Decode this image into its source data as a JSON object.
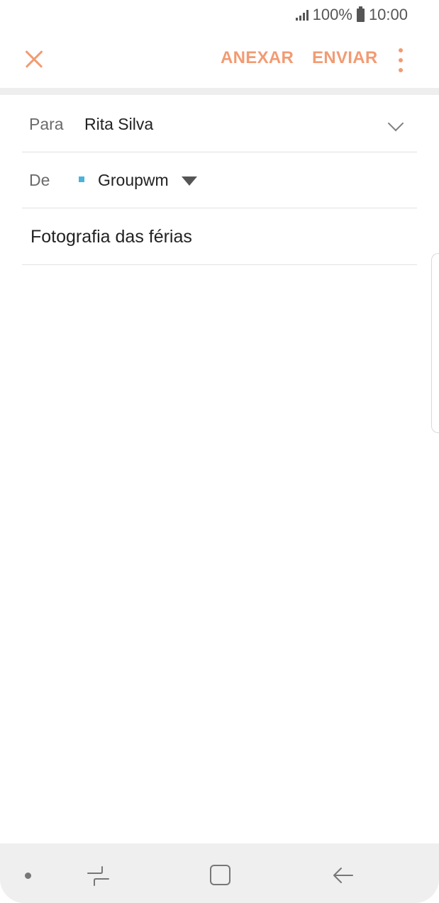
{
  "status_bar": {
    "battery": "100%",
    "time": "10:00",
    "icons": [
      "signal-icon",
      "battery-icon"
    ]
  },
  "toolbar": {
    "close_icon": "close-icon",
    "attach_label": "ANEXAR",
    "send_label": "ENVIAR",
    "more_icon": "more-vert-icon"
  },
  "compose": {
    "to_label": "Para",
    "to_value": "Rita Silva",
    "from_label": "De",
    "from_value": "Groupwm",
    "subject": "Fotografia das férias"
  },
  "nav_bar": {
    "icons": [
      "nav-dot",
      "recent-apps-icon",
      "home-icon",
      "back-icon"
    ]
  },
  "colors": {
    "accent": "#f29b73",
    "account_marker": "#4ab3dc",
    "divider": "#e2e2e2",
    "nav_background": "#efefef"
  }
}
